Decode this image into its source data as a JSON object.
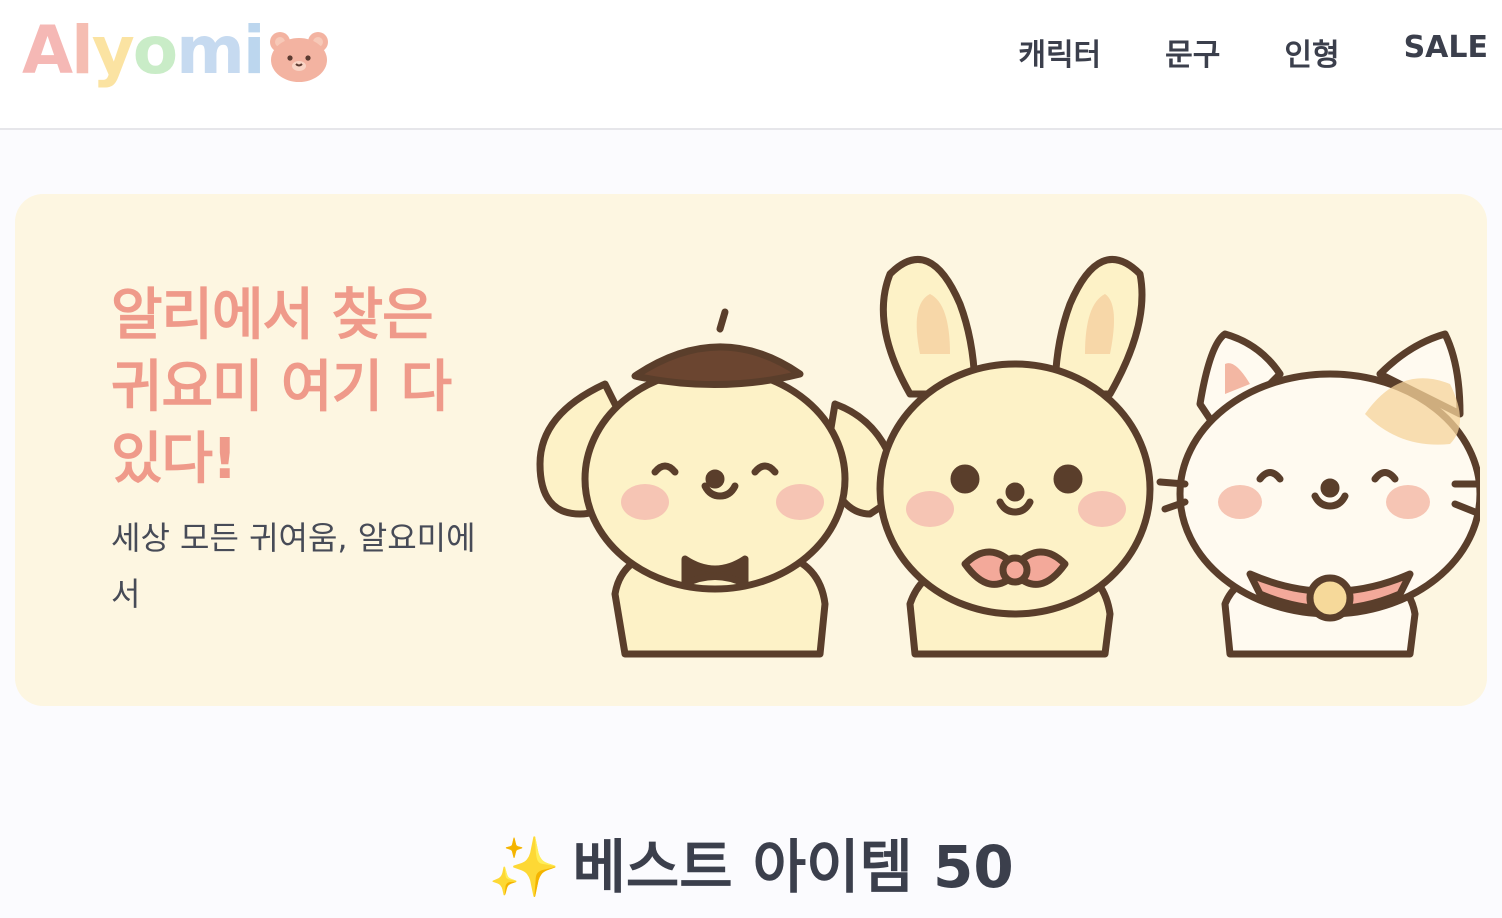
{
  "header": {
    "logo_letters": [
      "A",
      "l",
      "y",
      "o",
      "m",
      "i"
    ],
    "logo_colors": [
      "#f5b8b5",
      "#f5b8b5",
      "#fbe3a2",
      "#c9ecc7",
      "#c6daf0",
      "#bcd6ee"
    ],
    "logo_icon": "bear-face-icon",
    "nav": [
      {
        "label": "캐릭터"
      },
      {
        "label": "문구"
      },
      {
        "label": "인형"
      },
      {
        "label": "SALE"
      }
    ]
  },
  "hero": {
    "title": "알리에서 찾은 귀요미 여기 다 있다!",
    "subtitle": "세상 모든 귀여움, 알요미에서",
    "illustration": "three-cute-characters-dog-rabbit-cat",
    "background": "#fdf6e1",
    "accent": "#ef9a8a"
  },
  "best": {
    "icon": "sparkles-icon",
    "title": "베스트 아이템 50"
  }
}
